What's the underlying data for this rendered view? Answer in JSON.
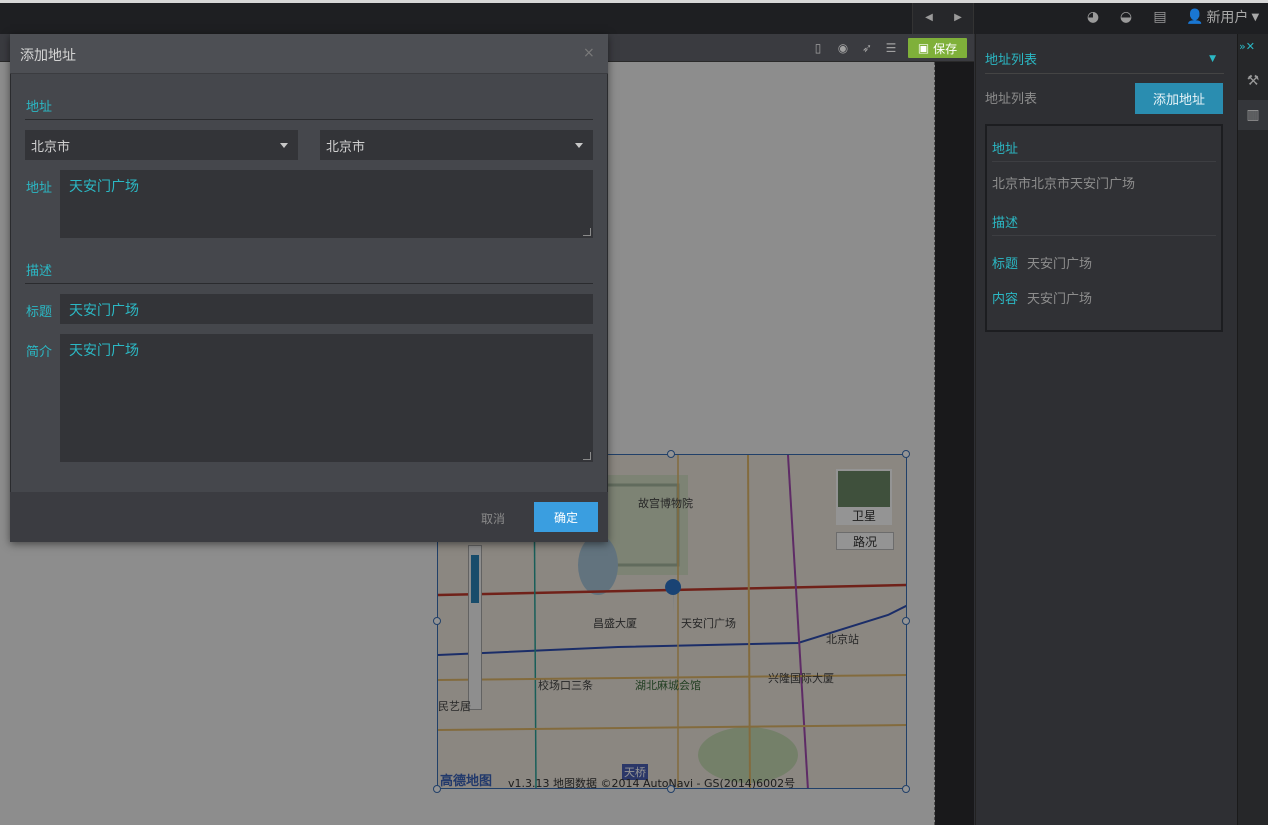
{
  "topbar": {
    "user_label": "新用户",
    "icons": [
      "chevron-left-icon",
      "chevron-right-icon",
      "globe-icon",
      "dashboard-icon",
      "list-icon",
      "user-icon"
    ]
  },
  "toolbar": {
    "save_label": "保存",
    "icons": [
      "mobile-icon",
      "eye-icon",
      "rocket-icon",
      "sliders-icon",
      "save-icon"
    ]
  },
  "colors": {
    "accent": "#2bb8c4",
    "save_green": "#7fb03a",
    "confirm_blue": "#3a9ee0",
    "add_button": "#2a8db0"
  },
  "modal": {
    "title": "添加地址",
    "close": "×",
    "section_address": "地址",
    "province": "北京市",
    "city": "北京市",
    "address_label": "地址",
    "address_value": "天安门广场",
    "section_desc": "描述",
    "title_label": "标题",
    "title_value": "天安门广场",
    "intro_label": "简介",
    "intro_value": "天安门广场",
    "cancel": "取消",
    "confirm": "确定"
  },
  "right_panel": {
    "header": "地址列表",
    "list_label": "地址列表",
    "add_button": "添加地址",
    "card": {
      "address_section": "地址",
      "address_text": "北京市北京市天安门广场",
      "desc_section": "描述",
      "title_label": "标题",
      "title_value": "天安门广场",
      "content_label": "内容",
      "content_value": "天安门广场"
    }
  },
  "map": {
    "labels": {
      "palace": "故宫博物院",
      "satellite": "卫星",
      "traffic": "路况",
      "changying": "昌盛大厦",
      "tiananmen": "天安门广场",
      "beijing_station": "北京站",
      "xiaochang": "校场口三条",
      "huguang": "湖北麻城会馆",
      "xinglong": "兴隆国际大厦",
      "minyi": "民艺居",
      "tianqiao": "天桥",
      "logo": "高德地图",
      "copyright": "v1.3.13 地图数据 ©2014 AutoNavi - GS(2014)6002号"
    }
  }
}
